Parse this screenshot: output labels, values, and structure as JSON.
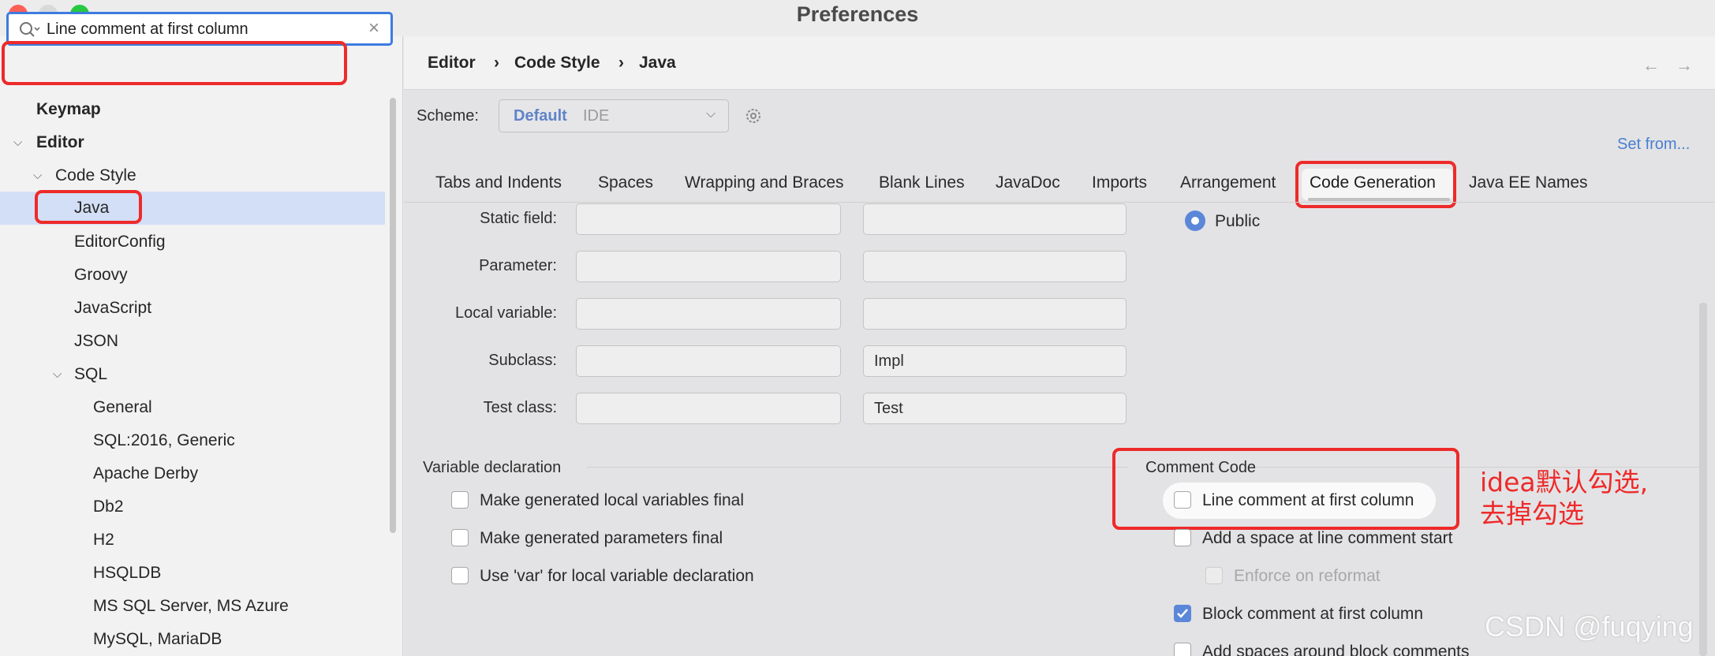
{
  "window": {
    "title": "Preferences"
  },
  "search": {
    "value": "Line comment at first column",
    "clear_icon": "×"
  },
  "tree": {
    "keymap": "Keymap",
    "editor": "Editor",
    "code_style": "Code Style",
    "java": "Java",
    "editorconfig": "EditorConfig",
    "groovy": "Groovy",
    "javascript": "JavaScript",
    "json": "JSON",
    "sql": "SQL",
    "general": "General",
    "sql2016": "SQL:2016, Generic",
    "derby": "Apache Derby",
    "db2": "Db2",
    "h2": "H2",
    "hsqldb": "HSQLDB",
    "mssql": "MS SQL Server, MS Azure",
    "mysql": "MySQL, MariaDB"
  },
  "breadcrumb": {
    "part1": "Editor",
    "part2": "Code Style",
    "part3": "Java",
    "sep": "›",
    "back": "←",
    "forward": "→"
  },
  "scheme": {
    "label": "Scheme:",
    "name": "Default",
    "type": "IDE",
    "set_from": "Set from..."
  },
  "tabs": [
    "Tabs and Indents",
    "Spaces",
    "Wrapping and Braces",
    "Blank Lines",
    "JavaDoc",
    "Imports",
    "Arrangement",
    "Code Generation",
    "Java EE Names"
  ],
  "naming": {
    "rows": [
      {
        "label": "Static field:",
        "prefix": "",
        "suffix": ""
      },
      {
        "label": "Parameter:",
        "prefix": "",
        "suffix": ""
      },
      {
        "label": "Local variable:",
        "prefix": "",
        "suffix": ""
      },
      {
        "label": "Subclass:",
        "prefix": "",
        "suffix": "Impl"
      },
      {
        "label": "Test class:",
        "prefix": "",
        "suffix": "Test"
      }
    ],
    "radio_public": "Public"
  },
  "variable_declaration": {
    "title": "Variable declaration",
    "items": [
      "Make generated local variables final",
      "Make generated parameters final",
      "Use 'var' for local variable declaration"
    ]
  },
  "comment_code": {
    "title": "Comment Code",
    "items": [
      {
        "label": "Line comment at first column",
        "checked": false
      },
      {
        "label": "Add a space at line comment start",
        "checked": false
      },
      {
        "label": "Enforce on reformat",
        "checked": false
      },
      {
        "label": "Block comment at first column",
        "checked": true
      },
      {
        "label": "Add spaces around block comments",
        "checked": false
      }
    ]
  },
  "annotation": {
    "line1": "idea默认勾选,",
    "line2": "去掉勾选"
  },
  "watermark": "CSDN @fuqying",
  "colors": {
    "accent": "#3d7be0",
    "highlight_red": "#ee2a2a",
    "selection": "#d3dff7"
  }
}
